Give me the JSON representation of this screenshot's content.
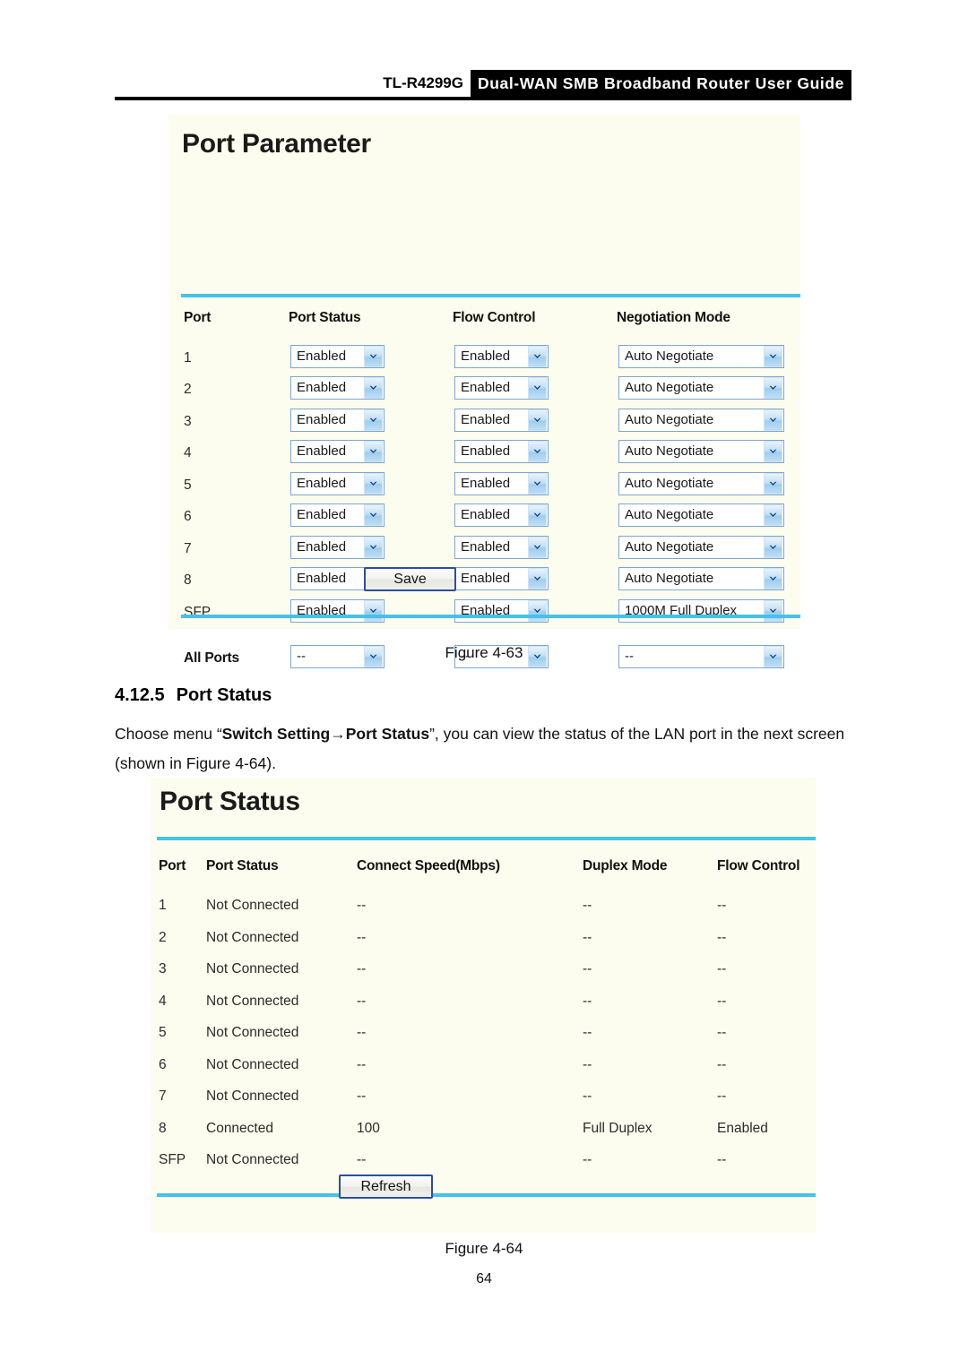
{
  "page": {
    "model": "TL-R4299G",
    "title": "Dual-WAN SMB Broadband Router User Guide",
    "page_number": "64"
  },
  "port_parameter": {
    "panel_title": "Port Parameter",
    "columns": [
      "Port",
      "Port Status",
      "Flow Control",
      "Negotiation Mode"
    ],
    "rows": [
      {
        "port": "1",
        "port_status": "Enabled",
        "flow_control": "Enabled",
        "negotiation_mode": "Auto Negotiate"
      },
      {
        "port": "2",
        "port_status": "Enabled",
        "flow_control": "Enabled",
        "negotiation_mode": "Auto Negotiate"
      },
      {
        "port": "3",
        "port_status": "Enabled",
        "flow_control": "Enabled",
        "negotiation_mode": "Auto Negotiate"
      },
      {
        "port": "4",
        "port_status": "Enabled",
        "flow_control": "Enabled",
        "negotiation_mode": "Auto Negotiate"
      },
      {
        "port": "5",
        "port_status": "Enabled",
        "flow_control": "Enabled",
        "negotiation_mode": "Auto Negotiate"
      },
      {
        "port": "6",
        "port_status": "Enabled",
        "flow_control": "Enabled",
        "negotiation_mode": "Auto Negotiate"
      },
      {
        "port": "7",
        "port_status": "Enabled",
        "flow_control": "Enabled",
        "negotiation_mode": "Auto Negotiate"
      },
      {
        "port": "8",
        "port_status": "Enabled",
        "flow_control": "Enabled",
        "negotiation_mode": "Auto Negotiate"
      },
      {
        "port": "SFP",
        "port_status": "Enabled",
        "flow_control": "Enabled",
        "negotiation_mode": "1000M Full Duplex"
      }
    ],
    "all_ports": {
      "label": "All Ports",
      "port_status": "--",
      "flow_control": "--",
      "negotiation_mode": "--"
    },
    "save_label": "Save"
  },
  "figure_63_caption": "Figure 4-63",
  "section": {
    "number": "4.12.5",
    "heading": "Port Status",
    "paragraph_prefix": "Choose menu “",
    "menu_path_1": "Switch Setting",
    "menu_arrow": "→",
    "menu_path_2": "Port Status",
    "paragraph_suffix": "”, you can view the status of the LAN port in the next screen (shown in Figure 4-64)."
  },
  "port_status": {
    "panel_title": "Port Status",
    "columns": [
      "Port",
      "Port Status",
      "Connect Speed(Mbps)",
      "Duplex Mode",
      "Flow Control"
    ],
    "rows": [
      {
        "port": "1",
        "status": "Not Connected",
        "speed": "--",
        "duplex": "--",
        "flow_control": "--"
      },
      {
        "port": "2",
        "status": "Not Connected",
        "speed": "--",
        "duplex": "--",
        "flow_control": "--"
      },
      {
        "port": "3",
        "status": "Not Connected",
        "speed": "--",
        "duplex": "--",
        "flow_control": "--"
      },
      {
        "port": "4",
        "status": "Not Connected",
        "speed": "--",
        "duplex": "--",
        "flow_control": "--"
      },
      {
        "port": "5",
        "status": "Not Connected",
        "speed": "--",
        "duplex": "--",
        "flow_control": "--"
      },
      {
        "port": "6",
        "status": "Not Connected",
        "speed": "--",
        "duplex": "--",
        "flow_control": "--"
      },
      {
        "port": "7",
        "status": "Not Connected",
        "speed": "--",
        "duplex": "--",
        "flow_control": "--"
      },
      {
        "port": "8",
        "status": "Connected",
        "speed": "100",
        "duplex": "Full Duplex",
        "flow_control": "Enabled"
      },
      {
        "port": "SFP",
        "status": "Not Connected",
        "speed": "--",
        "duplex": "--",
        "flow_control": "--"
      }
    ],
    "refresh_label": "Refresh"
  },
  "figure_64_caption": "Figure 4-64",
  "colors": {
    "panel_background": "#fcfdee",
    "divider_blue": "#45c1ea",
    "select_border": "#7ba7cf",
    "button_border": "#2a4f9e",
    "header_bar": "#000000"
  }
}
